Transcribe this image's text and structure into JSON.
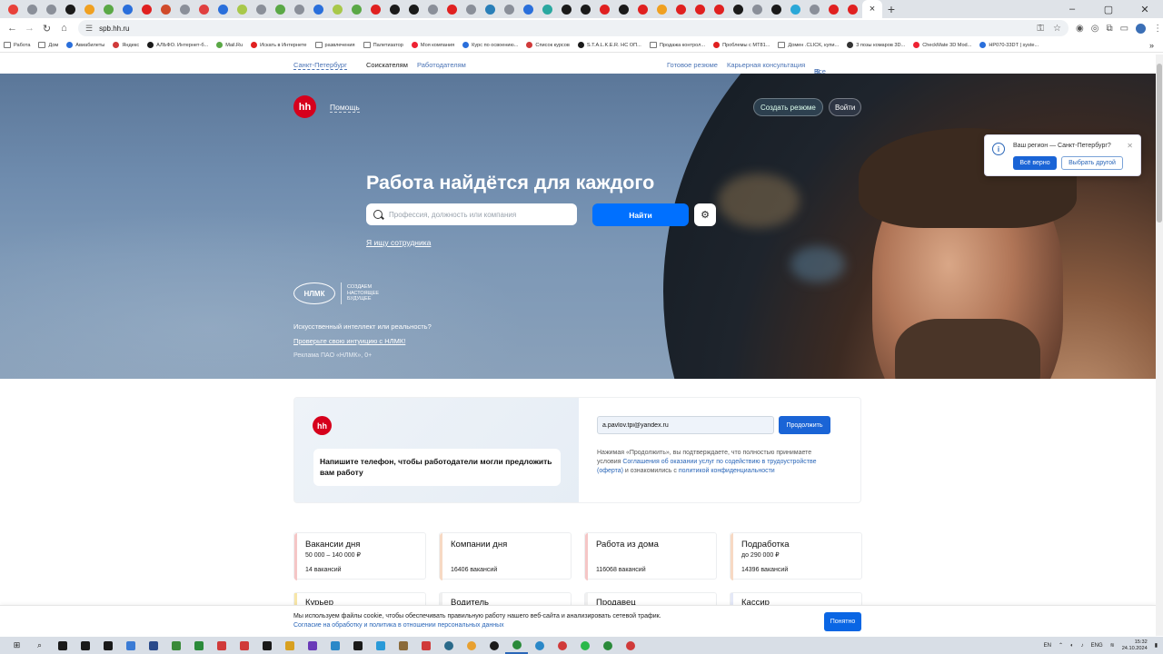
{
  "browser": {
    "url": "spb.hh.ru",
    "tab_favicon_colors": [
      "#e8413a",
      "#8a8f99",
      "#8a8f99",
      "#1a1a1a",
      "#f0a020",
      "#5aa846",
      "#2a6fdb",
      "#e02020",
      "#d04a2a",
      "#8a8f99",
      "#e04040",
      "#2a6fdb",
      "#a8c84a",
      "#8a8f99",
      "#5aa846",
      "#8a8f99",
      "#2a6fdb",
      "#a8c84a",
      "#5aa846",
      "#e02020",
      "#1a1a1a",
      "#1a1a1a",
      "#8a8f99",
      "#e02020",
      "#8a8f99",
      "#2a7fb8",
      "#8a8f99",
      "#2a6fdb",
      "#2aa8a0",
      "#1a1a1a",
      "#1a1a1a",
      "#e02020",
      "#1a1a1a",
      "#e02020",
      "#f0a020",
      "#e02020",
      "#e02020",
      "#e02020",
      "#1a1a1a",
      "#8a8f99",
      "#1a1a1a",
      "#2aa8d8",
      "#8a8f99",
      "#e02020",
      "#e02020"
    ],
    "active_tab_close": "×",
    "new_tab": "+",
    "window_controls": [
      "–",
      "▢",
      "✕"
    ],
    "bookmarks": [
      "Работа",
      "Дом",
      "Авиабилеты",
      "Яндекс",
      "АЛЬФО. Интернет-б...",
      "Mail.Ru",
      "Искать в Интернете",
      "развлечения",
      "Палетизатор",
      "Моя компания",
      "Курс по освоению...",
      "Список курсов",
      "S.T.A.L.K.E.R. НС ОП...",
      "Продажа контрол...",
      "Проблемы с МТ81...",
      "Домен .CLICK, купи...",
      "3 позы комаров 3D...",
      "CheckMate 3D Mod...",
      "НР070-33DT | syste..."
    ],
    "bookmarks_more": "»"
  },
  "topnav": {
    "city": "Санкт-Петербург",
    "seekers": "Соискателям",
    "employers": "Работодателям",
    "ready_resume": "Готовое резюме",
    "career": "Карьерная консультация",
    "all_services": "Все сервисы"
  },
  "hero": {
    "logo": "hh",
    "help": "Помощь",
    "create_resume": "Создать резюме",
    "login": "Войти",
    "headline": "Работа найдётся для каждого",
    "search_placeholder": "Профессия, должность или компания",
    "find": "Найти",
    "employee_link": "Я ищу сотрудника",
    "nlmk_logo": "НЛМК",
    "nlmk_slogan": "СОЗДАЕМ НАСТОЯЩЕЕ БУДУЩЕЕ",
    "ad_question": "Искусственный интеллект или реальность?",
    "ad_link": "Проверьте свою интуицию с НЛМК!",
    "ad_note": "Реклама ПАО «НЛМК», 0+"
  },
  "region_popup": {
    "question": "Ваш регион — Санкт-Петербург?",
    "yes": "Всё верно",
    "other": "Выбрать другой"
  },
  "phone_promo": {
    "logo": "hh",
    "text": "Напишите телефон, чтобы работодатели могли предложить вам работу",
    "email_value": "a.pavlov.tpi@yandex.ru",
    "continue": "Продолжить",
    "terms_prefix": "Нажимая «Продолжить», вы подтверждаете, что полностью принимаете условия ",
    "terms_link": "Соглашения об оказании услуг по содействию в трудоустройстве (оферта)",
    "terms_middle": " и ознакомились с ",
    "privacy_link": "политикой конфиденциальности"
  },
  "cards": [
    {
      "title": "Вакансии дня",
      "sub": "50 000 – 140 000 ₽",
      "count": "14 вакансий",
      "color": "#f5c6c6"
    },
    {
      "title": "Компании дня",
      "sub": "",
      "count": "16406 вакансий",
      "color": "#f7d9c4"
    },
    {
      "title": "Работа из дома",
      "sub": "",
      "count": "116068 вакансий",
      "color": "#f5c6c6"
    },
    {
      "title": "Подработка",
      "sub": "до 290 000 ₽",
      "count": "14396 вакансий",
      "color": "#f7d9c4"
    }
  ],
  "cards_row2": [
    {
      "title": "Курьер",
      "color": "#f7e6a8"
    },
    {
      "title": "Водитель",
      "color": "#f0f0f0"
    },
    {
      "title": "Продавец",
      "color": "#f0f0f0"
    },
    {
      "title": "Кассир",
      "color": "#e4e8f7"
    }
  ],
  "cookie": {
    "text": "Мы используем файлы cookie, чтобы обеспечивать правильную работу нашего веб-сайта и анализировать сетевой трафик.",
    "link": "Согласие на обработку и политика в отношении персональных данных",
    "ok": "Понятно"
  },
  "taskbar": {
    "lang_top": "EN",
    "lang": "ENG",
    "time": "15:32",
    "date": "24.10.2024",
    "app_colors": [
      "#1a1a1a",
      "#1a1a1a",
      "#1a1a1a",
      "#3a7bd5",
      "#2a4a8a",
      "#3a8a3a",
      "#2a8a3a",
      "#d03a3a",
      "#d03a3a",
      "#1a1a1a",
      "#d8a020",
      "#6a3ab8",
      "#2a88c8",
      "#1a1a1a",
      "#2a9ad8",
      "#8a6a3a",
      "#d03a3a",
      "#2a6a8a",
      "#e8a030",
      "#1a1a1a",
      "#2a8a3a",
      "#2a88c8",
      "#d03a3a",
      "#2ab84a",
      "#2a8a3a",
      "#d03a3a"
    ]
  }
}
